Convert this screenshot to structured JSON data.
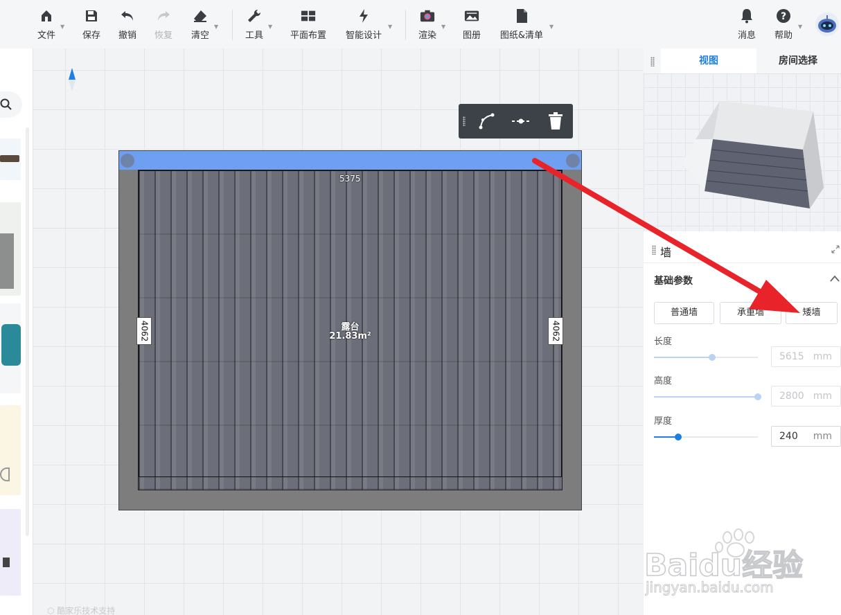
{
  "toolbar": {
    "file": "文件",
    "save": "保存",
    "undo": "撤销",
    "redo": "恢复",
    "clear": "清空",
    "tools": "工具",
    "floor_plan": "平面布置",
    "smart_design": "智能设计",
    "render": "渲染",
    "album": "图册",
    "drawings": "图纸&清单",
    "messages": "消息",
    "help": "帮助"
  },
  "canvas": {
    "dim_top": "5375",
    "dim_left": "4062",
    "dim_right": "4062",
    "room_name": "露台",
    "room_area": "21.83m²",
    "footer": "酷家乐技术支持"
  },
  "right_panel": {
    "tabs": [
      "视图",
      "房间选择"
    ],
    "section_title": "墙",
    "group_title": "基础参数",
    "wall_types": [
      "普通墙",
      "承重墙",
      "矮墙"
    ],
    "params": [
      {
        "label": "长度",
        "value": "5615",
        "unit": "mm",
        "level": 0.56
      },
      {
        "label": "高度",
        "value": "2800",
        "unit": "mm",
        "level": 1.0
      },
      {
        "label": "厚度",
        "value": "240",
        "unit": "mm",
        "level": 0.23
      }
    ]
  },
  "watermark": {
    "brand": "Baidu经验",
    "url": "jingyan.baidu.com"
  },
  "colors": {
    "accent": "#1e7fe0",
    "selected_wall": "#6e9ff0",
    "arrow": "#e8242a",
    "float_toolbar": "#3c4247"
  },
  "icons": [
    "home-icon",
    "save-icon",
    "undo-icon",
    "redo-icon",
    "eraser-icon",
    "wrench-icon",
    "grid-icon",
    "magic-icon",
    "camera-icon",
    "image-icon",
    "document-icon",
    "bell-icon",
    "help-icon",
    "robot-avatar-icon",
    "compass-icon",
    "search-icon",
    "curve-tool-icon",
    "split-tool-icon",
    "trash-icon",
    "expand-icon",
    "chevron-up-icon"
  ]
}
